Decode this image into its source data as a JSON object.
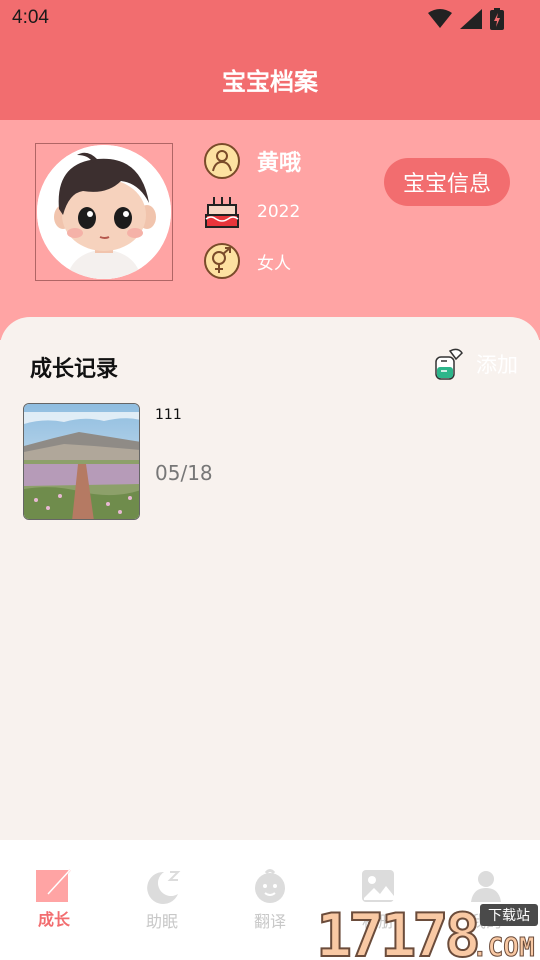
{
  "status_bar": {
    "time": "4:04",
    "icons": [
      "wifi-icon",
      "signal-icon",
      "battery-charging-icon"
    ]
  },
  "app_bar": {
    "title": "宝宝档案"
  },
  "profile": {
    "name": "黄哦",
    "birth_year": "2022",
    "gender": "女人",
    "info_button_label": "宝宝信息",
    "icons": [
      "person-icon",
      "birthday-cake-icon",
      "gender-icon"
    ]
  },
  "growth": {
    "section_title": "成长记录",
    "add_label": "添加",
    "records": [
      {
        "title": "111",
        "date": "05/18"
      }
    ]
  },
  "bottom_nav": {
    "items": [
      {
        "label": "成长",
        "icon": "growth-icon",
        "active": true
      },
      {
        "label": "助眠",
        "icon": "moon-icon",
        "active": false
      },
      {
        "label": "翻译",
        "icon": "baby-face-icon",
        "active": false
      },
      {
        "label": "相册",
        "icon": "photo-icon",
        "active": false
      },
      {
        "label": "我的",
        "icon": "user-icon",
        "active": false
      }
    ]
  },
  "watermark": {
    "brand": "17178",
    "suffix": ".COM",
    "tag": "下载站"
  },
  "colors": {
    "primary": "#f26d6f",
    "header_bg": "#ffa4a4",
    "content_bg": "#f8f2ee"
  }
}
